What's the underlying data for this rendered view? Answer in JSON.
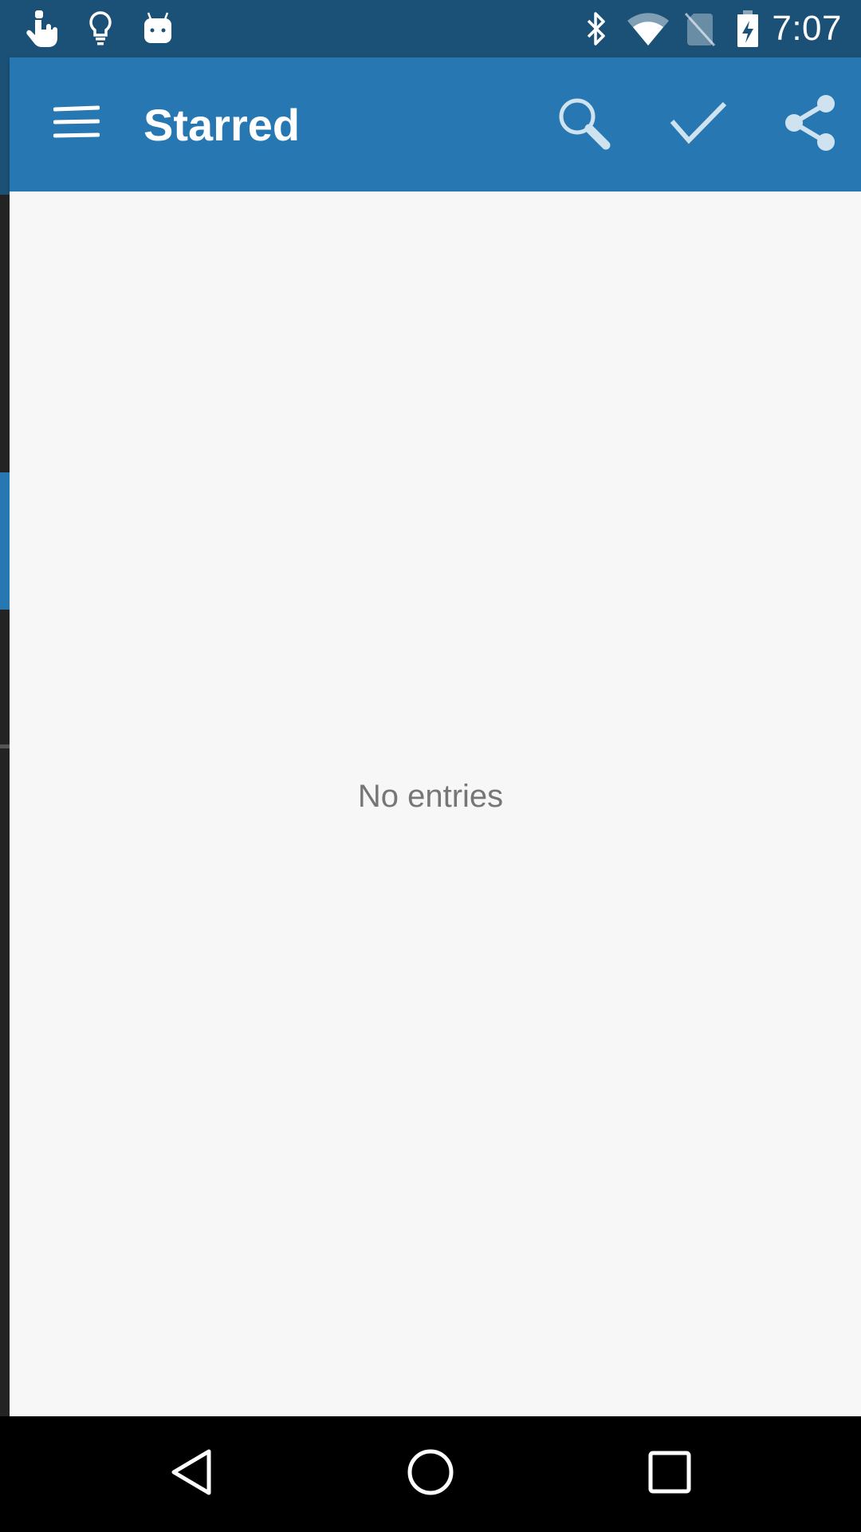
{
  "status_bar": {
    "time": "7:07",
    "left_icons": [
      "touch-icon",
      "lightbulb-icon",
      "android-icon"
    ],
    "right_icons": [
      "bluetooth-icon",
      "wifi-icon",
      "no-sim-icon",
      "battery-charging-icon"
    ]
  },
  "app_bar": {
    "title": "Starred",
    "menu_icon": "menu-icon",
    "actions": [
      "search-icon",
      "check-icon",
      "share-icon"
    ]
  },
  "content": {
    "empty_message": "No entries"
  },
  "nav_bar": {
    "buttons": [
      "back-icon",
      "home-icon",
      "recents-icon"
    ]
  },
  "colors": {
    "status_bar": "#1b5177",
    "app_bar": "#2778b2",
    "background": "#f7f7f7",
    "empty_text": "#767676"
  }
}
